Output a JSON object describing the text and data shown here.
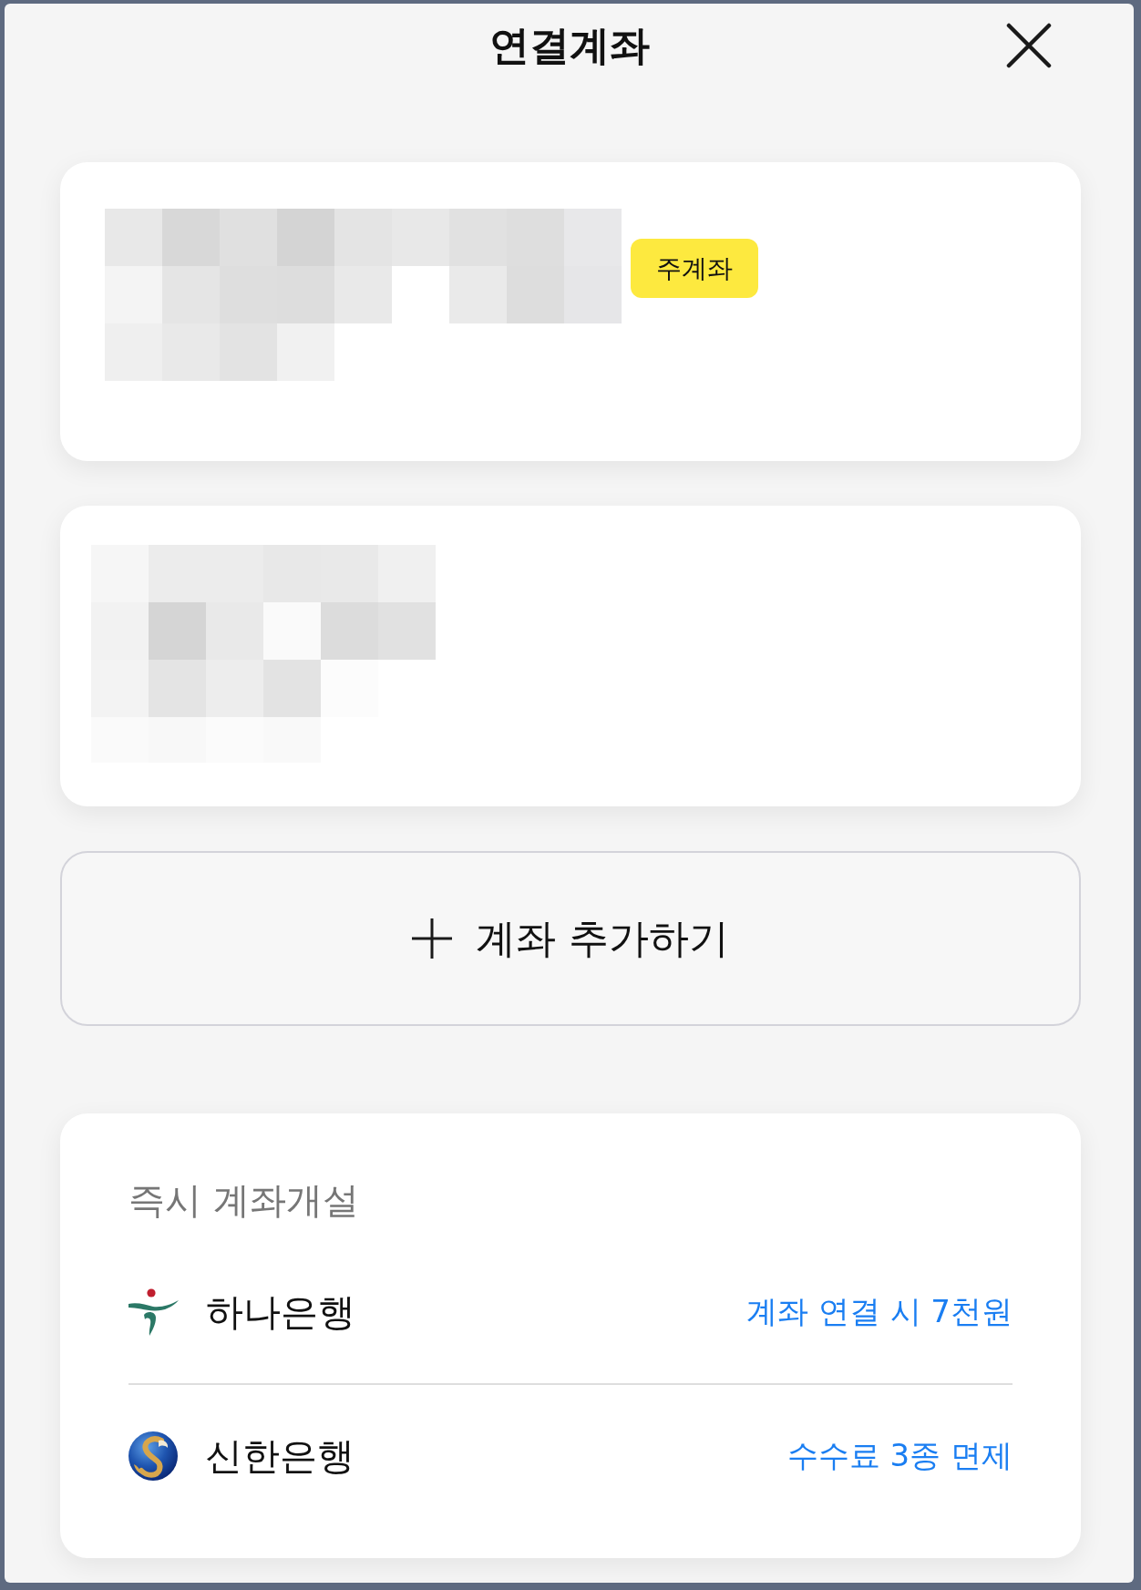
{
  "header": {
    "title": "연결계좌"
  },
  "accounts": [
    {
      "redacted": true,
      "badge": "주계좌"
    },
    {
      "redacted": true
    }
  ],
  "add_button": {
    "label": "계좌 추가하기"
  },
  "instant_open": {
    "title": "즉시 계좌개설",
    "banks": [
      {
        "kind": "figure",
        "name": "하나은행",
        "note": "계좌 연결 시 7천원"
      },
      {
        "kind": "globe",
        "name": "신한은행",
        "note": "수수료 3종 면제"
      }
    ]
  }
}
